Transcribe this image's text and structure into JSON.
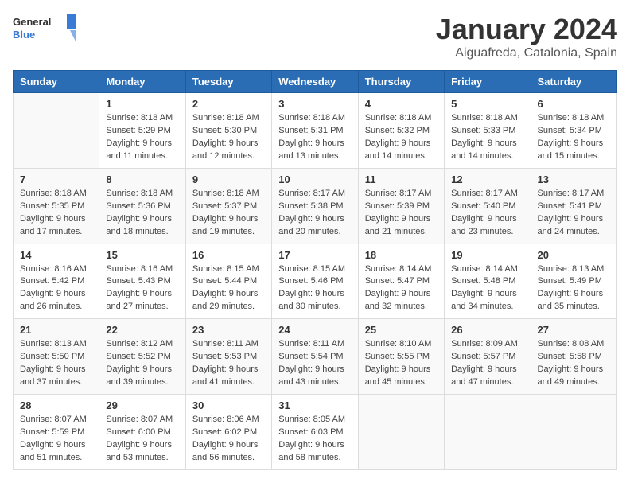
{
  "header": {
    "logo_general": "General",
    "logo_blue": "Blue",
    "month": "January 2024",
    "location": "Aiguafreda, Catalonia, Spain"
  },
  "days_of_week": [
    "Sunday",
    "Monday",
    "Tuesday",
    "Wednesday",
    "Thursday",
    "Friday",
    "Saturday"
  ],
  "weeks": [
    [
      {
        "day": "",
        "sunrise": "",
        "sunset": "",
        "daylight": ""
      },
      {
        "day": "1",
        "sunrise": "Sunrise: 8:18 AM",
        "sunset": "Sunset: 5:29 PM",
        "daylight": "Daylight: 9 hours and 11 minutes."
      },
      {
        "day": "2",
        "sunrise": "Sunrise: 8:18 AM",
        "sunset": "Sunset: 5:30 PM",
        "daylight": "Daylight: 9 hours and 12 minutes."
      },
      {
        "day": "3",
        "sunrise": "Sunrise: 8:18 AM",
        "sunset": "Sunset: 5:31 PM",
        "daylight": "Daylight: 9 hours and 13 minutes."
      },
      {
        "day": "4",
        "sunrise": "Sunrise: 8:18 AM",
        "sunset": "Sunset: 5:32 PM",
        "daylight": "Daylight: 9 hours and 14 minutes."
      },
      {
        "day": "5",
        "sunrise": "Sunrise: 8:18 AM",
        "sunset": "Sunset: 5:33 PM",
        "daylight": "Daylight: 9 hours and 14 minutes."
      },
      {
        "day": "6",
        "sunrise": "Sunrise: 8:18 AM",
        "sunset": "Sunset: 5:34 PM",
        "daylight": "Daylight: 9 hours and 15 minutes."
      }
    ],
    [
      {
        "day": "7",
        "sunrise": "Sunrise: 8:18 AM",
        "sunset": "Sunset: 5:35 PM",
        "daylight": "Daylight: 9 hours and 17 minutes."
      },
      {
        "day": "8",
        "sunrise": "Sunrise: 8:18 AM",
        "sunset": "Sunset: 5:36 PM",
        "daylight": "Daylight: 9 hours and 18 minutes."
      },
      {
        "day": "9",
        "sunrise": "Sunrise: 8:18 AM",
        "sunset": "Sunset: 5:37 PM",
        "daylight": "Daylight: 9 hours and 19 minutes."
      },
      {
        "day": "10",
        "sunrise": "Sunrise: 8:17 AM",
        "sunset": "Sunset: 5:38 PM",
        "daylight": "Daylight: 9 hours and 20 minutes."
      },
      {
        "day": "11",
        "sunrise": "Sunrise: 8:17 AM",
        "sunset": "Sunset: 5:39 PM",
        "daylight": "Daylight: 9 hours and 21 minutes."
      },
      {
        "day": "12",
        "sunrise": "Sunrise: 8:17 AM",
        "sunset": "Sunset: 5:40 PM",
        "daylight": "Daylight: 9 hours and 23 minutes."
      },
      {
        "day": "13",
        "sunrise": "Sunrise: 8:17 AM",
        "sunset": "Sunset: 5:41 PM",
        "daylight": "Daylight: 9 hours and 24 minutes."
      }
    ],
    [
      {
        "day": "14",
        "sunrise": "Sunrise: 8:16 AM",
        "sunset": "Sunset: 5:42 PM",
        "daylight": "Daylight: 9 hours and 26 minutes."
      },
      {
        "day": "15",
        "sunrise": "Sunrise: 8:16 AM",
        "sunset": "Sunset: 5:43 PM",
        "daylight": "Daylight: 9 hours and 27 minutes."
      },
      {
        "day": "16",
        "sunrise": "Sunrise: 8:15 AM",
        "sunset": "Sunset: 5:44 PM",
        "daylight": "Daylight: 9 hours and 29 minutes."
      },
      {
        "day": "17",
        "sunrise": "Sunrise: 8:15 AM",
        "sunset": "Sunset: 5:46 PM",
        "daylight": "Daylight: 9 hours and 30 minutes."
      },
      {
        "day": "18",
        "sunrise": "Sunrise: 8:14 AM",
        "sunset": "Sunset: 5:47 PM",
        "daylight": "Daylight: 9 hours and 32 minutes."
      },
      {
        "day": "19",
        "sunrise": "Sunrise: 8:14 AM",
        "sunset": "Sunset: 5:48 PM",
        "daylight": "Daylight: 9 hours and 34 minutes."
      },
      {
        "day": "20",
        "sunrise": "Sunrise: 8:13 AM",
        "sunset": "Sunset: 5:49 PM",
        "daylight": "Daylight: 9 hours and 35 minutes."
      }
    ],
    [
      {
        "day": "21",
        "sunrise": "Sunrise: 8:13 AM",
        "sunset": "Sunset: 5:50 PM",
        "daylight": "Daylight: 9 hours and 37 minutes."
      },
      {
        "day": "22",
        "sunrise": "Sunrise: 8:12 AM",
        "sunset": "Sunset: 5:52 PM",
        "daylight": "Daylight: 9 hours and 39 minutes."
      },
      {
        "day": "23",
        "sunrise": "Sunrise: 8:11 AM",
        "sunset": "Sunset: 5:53 PM",
        "daylight": "Daylight: 9 hours and 41 minutes."
      },
      {
        "day": "24",
        "sunrise": "Sunrise: 8:11 AM",
        "sunset": "Sunset: 5:54 PM",
        "daylight": "Daylight: 9 hours and 43 minutes."
      },
      {
        "day": "25",
        "sunrise": "Sunrise: 8:10 AM",
        "sunset": "Sunset: 5:55 PM",
        "daylight": "Daylight: 9 hours and 45 minutes."
      },
      {
        "day": "26",
        "sunrise": "Sunrise: 8:09 AM",
        "sunset": "Sunset: 5:57 PM",
        "daylight": "Daylight: 9 hours and 47 minutes."
      },
      {
        "day": "27",
        "sunrise": "Sunrise: 8:08 AM",
        "sunset": "Sunset: 5:58 PM",
        "daylight": "Daylight: 9 hours and 49 minutes."
      }
    ],
    [
      {
        "day": "28",
        "sunrise": "Sunrise: 8:07 AM",
        "sunset": "Sunset: 5:59 PM",
        "daylight": "Daylight: 9 hours and 51 minutes."
      },
      {
        "day": "29",
        "sunrise": "Sunrise: 8:07 AM",
        "sunset": "Sunset: 6:00 PM",
        "daylight": "Daylight: 9 hours and 53 minutes."
      },
      {
        "day": "30",
        "sunrise": "Sunrise: 8:06 AM",
        "sunset": "Sunset: 6:02 PM",
        "daylight": "Daylight: 9 hours and 56 minutes."
      },
      {
        "day": "31",
        "sunrise": "Sunrise: 8:05 AM",
        "sunset": "Sunset: 6:03 PM",
        "daylight": "Daylight: 9 hours and 58 minutes."
      },
      {
        "day": "",
        "sunrise": "",
        "sunset": "",
        "daylight": ""
      },
      {
        "day": "",
        "sunrise": "",
        "sunset": "",
        "daylight": ""
      },
      {
        "day": "",
        "sunrise": "",
        "sunset": "",
        "daylight": ""
      }
    ]
  ]
}
